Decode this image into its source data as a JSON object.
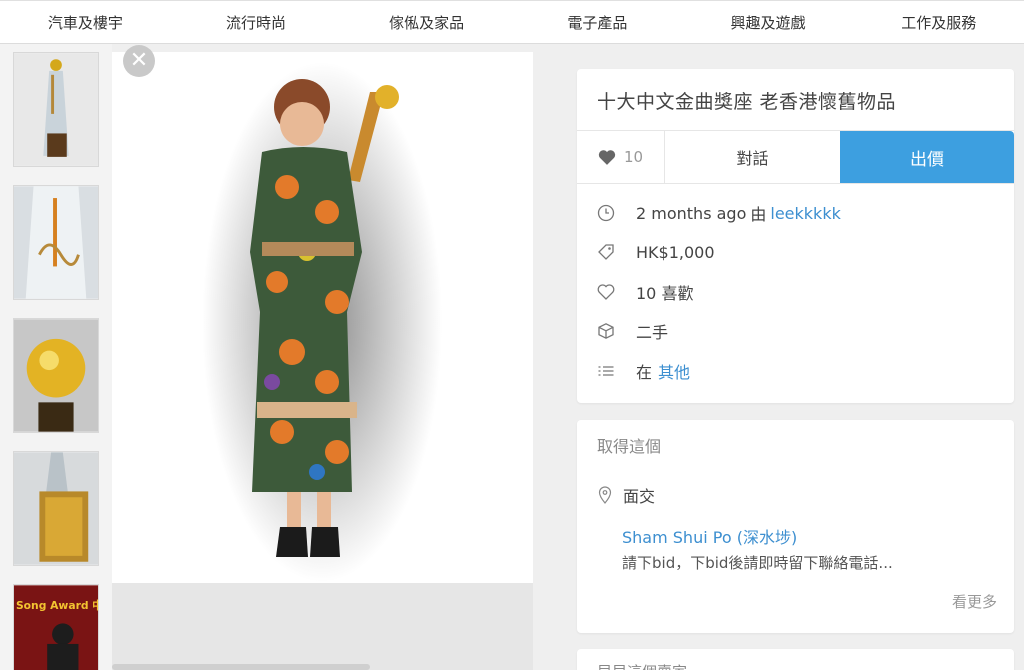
{
  "nav": {
    "items": [
      "汽車及樓宇",
      "流行時尚",
      "傢俬及家品",
      "電子產品",
      "興趣及遊戲",
      "工作及服務"
    ]
  },
  "photo_viewer": {
    "close_glyph": "✕",
    "thumb_caption_text": "Song Award 中文金曲"
  },
  "listing": {
    "title": "十大中文金曲獎座  老香港懷舊物品",
    "like_count": "10",
    "chat_label": "對話",
    "offer_label": "出價",
    "time_ago": "2 months ago",
    "by_label": "由",
    "seller": "leekkkkk",
    "price": "HK$1,000",
    "likes_text": "10 喜歡",
    "condition": "二手",
    "category_prefix": "在",
    "category": "其他"
  },
  "delivery": {
    "heading": "取得這個",
    "method": "面交",
    "location": "Sham Shui Po (深水埗)",
    "note": "請下bid，下bid後請即時留下聯絡電話...",
    "more_label": "看更多"
  },
  "next_card": {
    "partial_text": "早早這個賣家"
  },
  "colors": {
    "accent_blue": "#3d9fe0",
    "link_blue": "#3d8fd0",
    "page_bg": "#efefef",
    "card_bg": "#ffffff"
  },
  "icons": [
    "heart-icon",
    "clock-icon",
    "tag-icon",
    "heart-outline-icon",
    "box-icon",
    "list-icon",
    "map-pin-icon",
    "close-icon"
  ]
}
